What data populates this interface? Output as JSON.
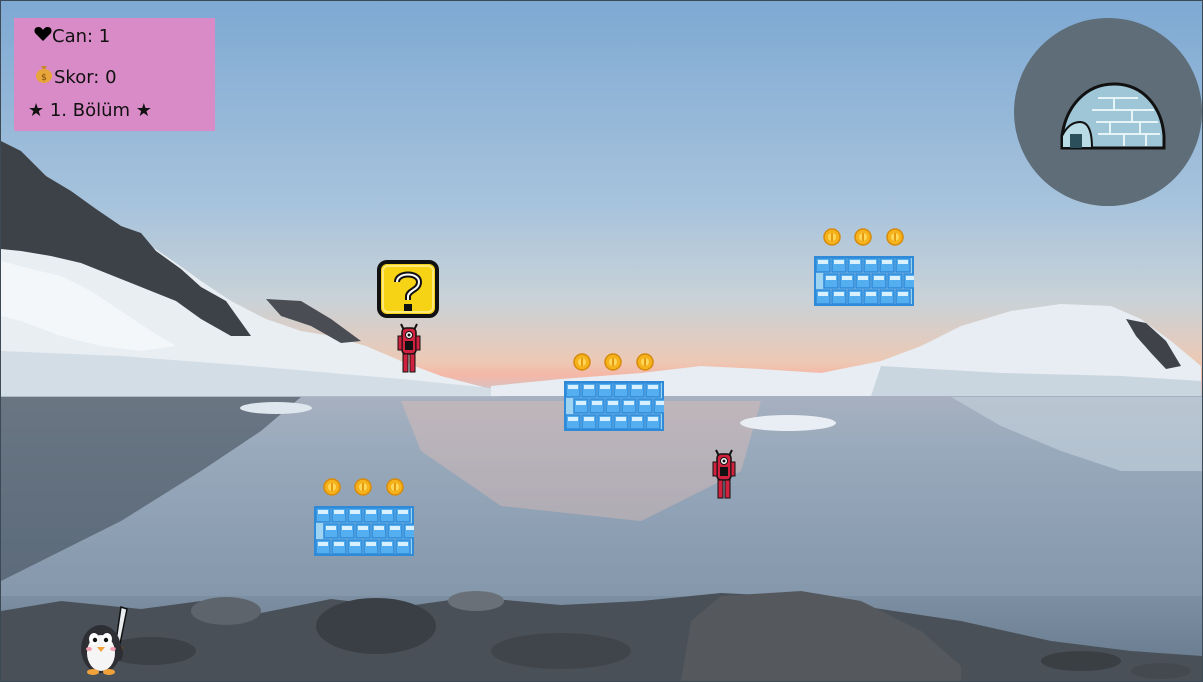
{
  "hud": {
    "lives_icon": "heart-icon",
    "lives_text": "Can: 1",
    "score_icon": "money-bag-icon",
    "score_text": "Skor: 0",
    "level_text": "★ 1. Bölüm ★"
  },
  "igloo_button": {
    "icon": "igloo-icon"
  },
  "colors": {
    "hud_background": "#d88bc6",
    "platform_blue": "#2f8ad8",
    "coin_gold": "#f6b21b",
    "monster_red": "#d0213f",
    "question_block": "#f7d316"
  },
  "scene": {
    "background": "arctic lake with snowy mountains",
    "platforms": [
      "ice-brick",
      "ice-brick",
      "ice-brick"
    ],
    "coins_per_platform": 3,
    "monsters": 2,
    "question_blocks": 1,
    "player": "penguin-with-sword"
  }
}
